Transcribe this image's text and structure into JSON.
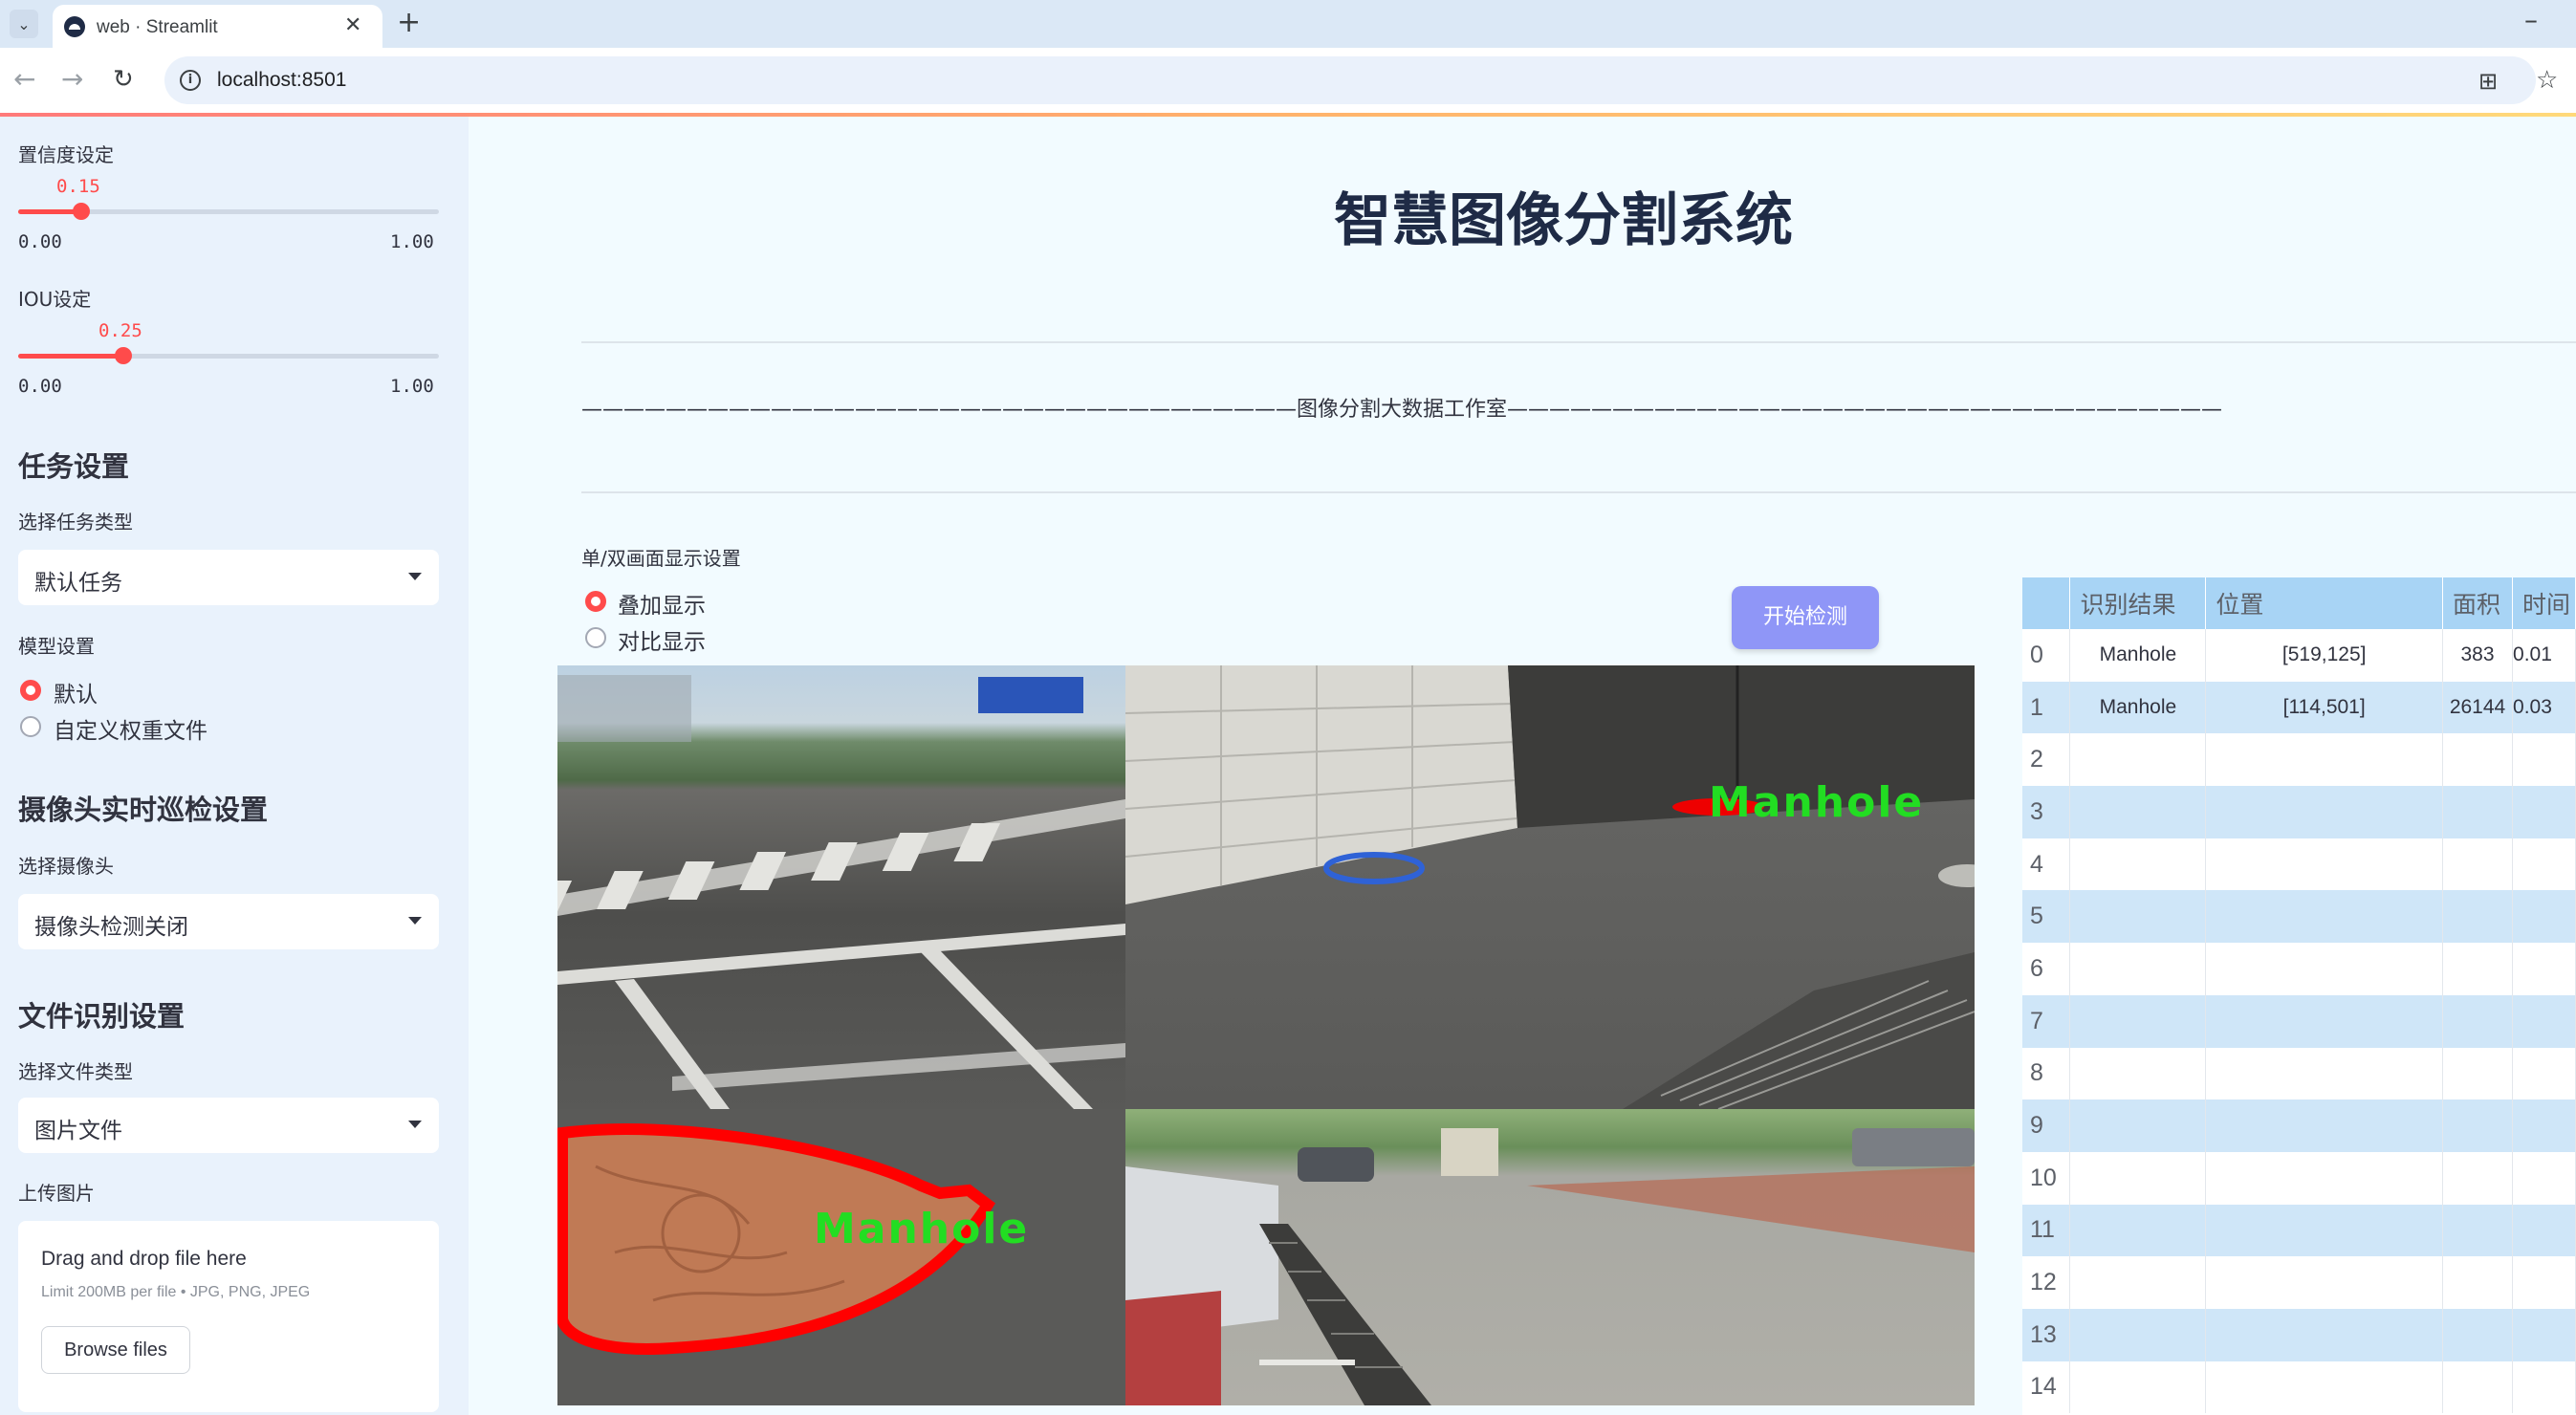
{
  "browser": {
    "tab_title": "web · Streamlit",
    "url": "localhost:8501"
  },
  "sidebar": {
    "confidence": {
      "label": "置信度设定",
      "value": "0.15",
      "value_num": 0.15,
      "min": "0.00",
      "max": "1.00"
    },
    "iou": {
      "label": "IOU设定",
      "value": "0.25",
      "value_num": 0.25,
      "min": "0.00",
      "max": "1.00"
    },
    "task_heading": "任务设置",
    "task_type_label": "选择任务类型",
    "task_type_value": "默认任务",
    "model_label": "模型设置",
    "model_options": [
      "默认",
      "自定义权重文件"
    ],
    "model_selected": "默认",
    "camera_heading": "摄像头实时巡检设置",
    "camera_label": "选择摄像头",
    "camera_value": "摄像头检测关闭",
    "file_heading": "文件识别设置",
    "file_type_label": "选择文件类型",
    "file_type_value": "图片文件",
    "upload_label": "上传图片",
    "upload_main": "Drag and drop file here",
    "upload_sub": "Limit 200MB per file • JPG, PNG, JPEG",
    "browse_label": "Browse files"
  },
  "main": {
    "title": "智慧图像分割系统",
    "divider_text": "——————————————————————————————————图像分割大数据工作室——————————————————————————————————",
    "display_label": "单/双画面显示设置",
    "display_options": [
      "叠加显示",
      "对比显示"
    ],
    "display_selected": "叠加显示",
    "start_button": "开始检测",
    "mask_labels": [
      "Manhole",
      "Manhole"
    ]
  },
  "table": {
    "columns": [
      "识别结果",
      "位置",
      "面积",
      "时间"
    ],
    "rows": [
      {
        "index": "0",
        "result": "Manhole",
        "position": "[519,125]",
        "area": "383",
        "time": "0.01"
      },
      {
        "index": "1",
        "result": "Manhole",
        "position": "[114,501]",
        "area": "26144",
        "time": "0.03"
      },
      {
        "index": "2"
      },
      {
        "index": "3"
      },
      {
        "index": "4"
      },
      {
        "index": "5"
      },
      {
        "index": "6"
      },
      {
        "index": "7"
      },
      {
        "index": "8"
      },
      {
        "index": "9"
      },
      {
        "index": "10"
      },
      {
        "index": "11"
      },
      {
        "index": "12"
      },
      {
        "index": "13"
      },
      {
        "index": "14"
      }
    ]
  },
  "colors": {
    "accent": "#ff4b4b",
    "primary_button": "#8f96f7",
    "table_header": "#a8d4f5",
    "mask_outline": "#ff0000",
    "mask_label": "#22dd22"
  }
}
